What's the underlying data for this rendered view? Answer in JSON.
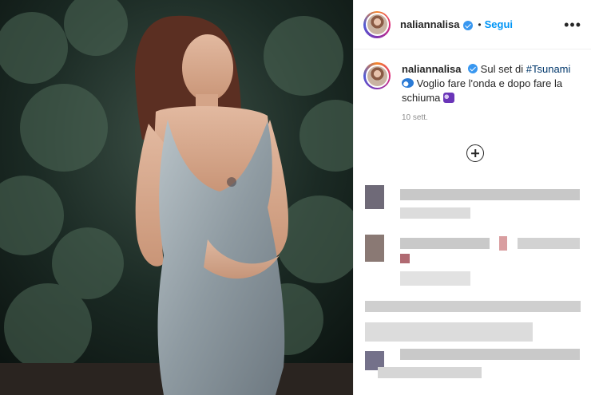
{
  "post": {
    "username": "naliannalisa",
    "follow_label": "Segui",
    "caption": {
      "username": "naliannalisa",
      "text_before": "Sul set di ",
      "hashtag": "#Tsunami",
      "text_after": "Voglio fare l'onda e dopo fare la schiuma",
      "emoji_1": "wave-emoji",
      "emoji_2": "bubbles-emoji"
    },
    "time": "10 sett."
  },
  "colors": {
    "link": "#0095f6",
    "verified": "#3897f0",
    "text": "#262626",
    "muted": "#8e8e8e"
  }
}
